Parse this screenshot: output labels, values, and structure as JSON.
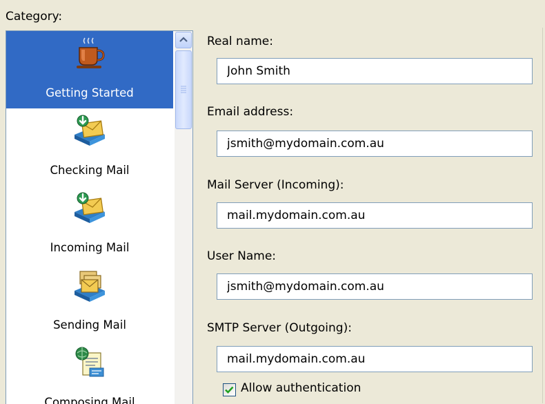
{
  "category": {
    "label": "Category:",
    "items": [
      {
        "label": "Getting Started",
        "icon": "coffee-cup-icon",
        "selected": true
      },
      {
        "label": "Checking Mail",
        "icon": "mail-download-icon",
        "selected": false
      },
      {
        "label": "Incoming Mail",
        "icon": "mail-download-icon",
        "selected": false
      },
      {
        "label": "Sending Mail",
        "icon": "mail-send-icon",
        "selected": false
      },
      {
        "label": "Composing Mail",
        "icon": "compose-mail-icon",
        "selected": false
      }
    ]
  },
  "form": {
    "real_name": {
      "label": "Real name:",
      "value": "John Smith"
    },
    "email": {
      "label": "Email address:",
      "value": "jsmith@mydomain.com.au"
    },
    "incoming": {
      "label": "Mail Server (Incoming):",
      "value": "mail.mydomain.com.au"
    },
    "username": {
      "label": "User Name:",
      "value": "jsmith@mydomain.com.au"
    },
    "smtp": {
      "label": "SMTP Server (Outgoing):",
      "value": "mail.mydomain.com.au"
    },
    "allow_auth": {
      "label": "Allow authentication",
      "checked": true
    }
  },
  "colors": {
    "selection": "#316ac5",
    "field_border": "#7f9db9",
    "dialog_bg": "#ece9d8"
  }
}
